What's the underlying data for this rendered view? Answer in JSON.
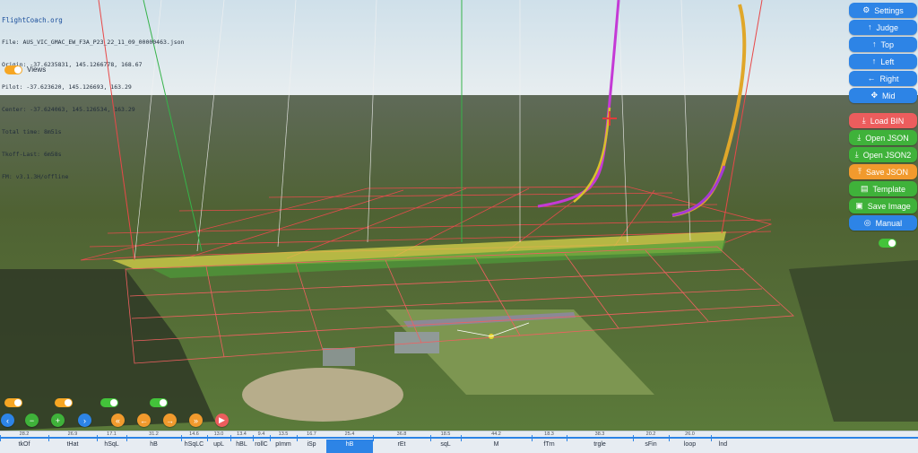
{
  "info": {
    "brand": "FlightCoach.org",
    "lines": [
      "File: AUS_VIC_GMAC_EW_F3A_P23_22_11_09_00000463.json",
      "Origin: -37.6235831, 145.1266778, 168.67",
      "Pilot: -37.623620, 145.126693, 163.29",
      "Center: -37.624063, 145.126534, 163.29",
      "Total time: 8m51s",
      "Tkoff-Last: 6m58s",
      "FM: v3.1.3H/offline"
    ]
  },
  "views_label": "Views",
  "panel": {
    "settings": "Settings",
    "judge": "Judge",
    "top": "Top",
    "left": "Left",
    "right": "Right",
    "mid": "Mid",
    "load_bin": "Load BIN",
    "open_json": "Open JSON",
    "open_json2": "Open JSON2",
    "save_json": "Save JSON",
    "template": "Template",
    "save_image": "Save Image",
    "manual": "Manual"
  },
  "icons": {
    "settings": "gear-icon",
    "judge": "arrow-up-icon",
    "top": "arrow-up-icon",
    "left": "arrow-up-icon",
    "right": "arrow-left-icon",
    "mid": "move-icon",
    "load_bin": "download-icon",
    "open_json": "download-icon",
    "open_json2": "download-icon",
    "save_json": "upload-icon",
    "template": "document-icon",
    "save_image": "image-icon",
    "manual": "lifebuoy-icon"
  },
  "colors": {
    "accent_blue": "#2d84e6",
    "red": "#ec5d5d",
    "green": "#3fb23a",
    "orange": "#f19a2d"
  },
  "timeline": {
    "segments": [
      {
        "name": "tkOf",
        "value": "28.2"
      },
      {
        "name": "tHat",
        "value": "26.9"
      },
      {
        "name": "hSqL",
        "value": "17.1"
      },
      {
        "name": "hB",
        "value": "31.2"
      },
      {
        "name": "hSqLC",
        "value": "14.6"
      },
      {
        "name": "upL",
        "value": "13.0"
      },
      {
        "name": "hBL",
        "value": "13.4"
      },
      {
        "name": "rollC",
        "value": "9.4"
      },
      {
        "name": "pImm",
        "value": "13.5"
      },
      {
        "name": "iSp",
        "value": "16.7"
      },
      {
        "name": "hB",
        "value": "25.4"
      },
      {
        "name": "rEt",
        "value": "36.8"
      },
      {
        "name": "sqL",
        "value": "18.5"
      },
      {
        "name": "M",
        "value": "44.2"
      },
      {
        "name": "fTrn",
        "value": "18.3"
      },
      {
        "name": "trgle",
        "value": "38.3"
      },
      {
        "name": "sFin",
        "value": "20.2"
      },
      {
        "name": "loop",
        "value": "26.0"
      },
      {
        "name": "lnd",
        "value": ""
      }
    ],
    "selected_index": 10
  }
}
